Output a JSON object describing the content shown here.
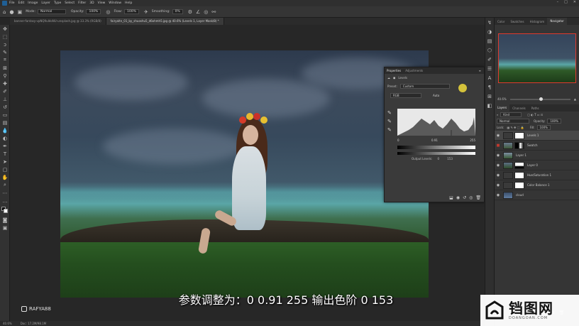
{
  "menubar": {
    "items": [
      "File",
      "Edit",
      "Image",
      "Layer",
      "Type",
      "Select",
      "Filter",
      "3D",
      "View",
      "Window",
      "Help"
    ],
    "window_controls": [
      "–",
      "□",
      "✕"
    ]
  },
  "options": {
    "mode_label": "Mode:",
    "mode_value": "Normal",
    "opacity_label": "Opacity:",
    "opacity_value": "100%",
    "flow_label": "Flow:",
    "flow_value": "100%",
    "smoothing_label": "Smoothing:",
    "smoothing_value": "0%"
  },
  "tabs": [
    {
      "label": "banner-fantasy-vpNQ9uIdoNU-unsplash.jpg @ 33.3% (RGB/8)",
      "active": false
    },
    {
      "label": "fairyaltn_01_by_shuoshu5_d6ohmh5.jpg @ 40.6% (Levels 1, Layer Mask/8) *",
      "active": true
    }
  ],
  "toolbar_icons": [
    "move-icon",
    "marquee-icon",
    "lasso-icon",
    "quick-select-icon",
    "crop-icon",
    "frame-icon",
    "eyedropper-icon",
    "healing-icon",
    "brush-icon",
    "clone-stamp-icon",
    "history-brush-icon",
    "eraser-icon",
    "gradient-icon",
    "blur-icon",
    "dodge-icon",
    "pen-icon",
    "type-icon",
    "path-select-icon",
    "shape-icon",
    "hand-icon",
    "zoom-icon",
    "more-icon"
  ],
  "properties": {
    "tabs": [
      "Properties",
      "Adjustments"
    ],
    "title": "Levels",
    "preset_label": "Preset:",
    "preset_value": "Custom",
    "channel_value": "RGB",
    "auto_label": "Auto",
    "input_levels": [
      "0",
      "0.91",
      "255"
    ],
    "output_label": "Output Levels:",
    "output_levels": [
      "0",
      "153"
    ]
  },
  "right_panel": {
    "tabs": [
      "Color",
      "Swatches",
      "Histogram",
      "Navigator"
    ],
    "active_tab": "Navigator",
    "zoom_value": "40.6%",
    "layer_tabs": [
      "Layers",
      "Channels",
      "Paths"
    ],
    "kind_label": "Kind",
    "blend_mode": "Normal",
    "opacity_label": "Opacity:",
    "opacity_value": "100%",
    "lock_label": "Lock:",
    "fill_label": "Fill:",
    "fill_value": "100%",
    "layers": [
      {
        "name": "Levels 1",
        "visible": true,
        "active": true,
        "has_mask": true
      },
      {
        "name": "Swatch",
        "visible": false,
        "active": false,
        "has_mask": true
      },
      {
        "name": "Layer 1",
        "visible": true,
        "active": false,
        "has_mask": false
      },
      {
        "name": "Layer 0",
        "visible": true,
        "active": false,
        "has_mask": true
      },
      {
        "name": "Hue/Saturation 1",
        "visible": true,
        "active": false,
        "has_mask": true
      },
      {
        "name": "Color Balance 1",
        "visible": true,
        "active": false,
        "has_mask": true
      },
      {
        "name": "cloud",
        "visible": true,
        "active": false,
        "has_mask": false
      }
    ]
  },
  "statusbar": {
    "zoom": "40.6%",
    "doc": "Doc: 17.2M/98.1M"
  },
  "overlay": {
    "subtitle": "参数调整为：0 0.91 255  输出色阶 0 153",
    "handle": "RAFYA88"
  },
  "watermark": {
    "big": "铛图网",
    "small": "DOANGOAN.COM"
  },
  "colors": {
    "accent_red": "#e03a2e",
    "cursor_yellow": "#e6d23c"
  }
}
